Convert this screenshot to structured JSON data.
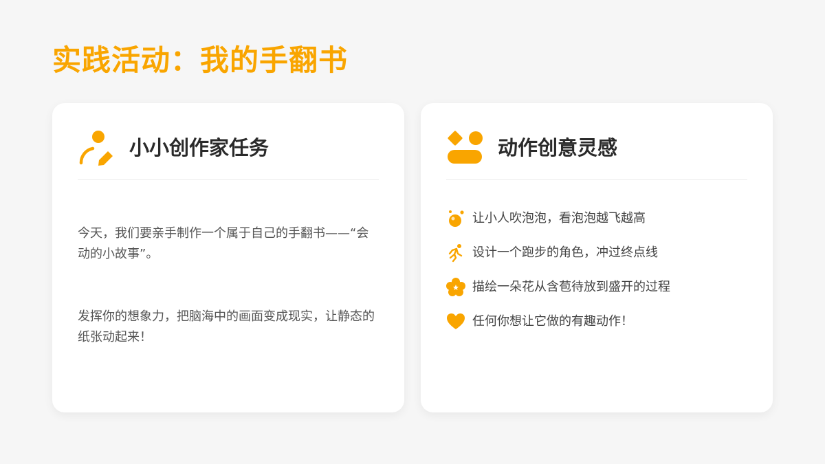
{
  "colors": {
    "accent": "#f9a500",
    "background": "#f6f6f6",
    "card": "#ffffff",
    "heading_text": "#2a2a2a",
    "body_text": "#555555"
  },
  "page": {
    "title": "实践活动：我的手翻书"
  },
  "left_card": {
    "icon": "person-pencil-icon",
    "title": "小小创作家任务",
    "paragraphs": [
      "今天，我们要亲手制作一个属于自己的手翻书——“会动的小故事”。",
      "发挥你的想象力，把脑海中的画面变成现实，让静态的纸张动起来！"
    ]
  },
  "right_card": {
    "icon": "shapes-icon",
    "title": "动作创意灵感",
    "items": [
      {
        "icon": "bubble-icon",
        "text": "让小人吹泡泡，看泡泡越飞越高"
      },
      {
        "icon": "running-icon",
        "text": "设计一个跑步的角色，冲过终点线"
      },
      {
        "icon": "flower-icon",
        "text": "描绘一朵花从含苞待放到盛开的过程"
      },
      {
        "icon": "heart-icon",
        "text": "任何你想让它做的有趣动作！"
      }
    ]
  }
}
